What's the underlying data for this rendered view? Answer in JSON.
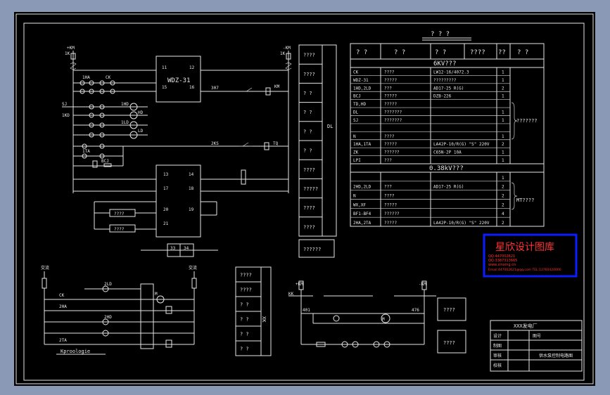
{
  "drawing": {
    "background_color": "#000000",
    "line_color": "#e6e6e6",
    "frame_color": "#8a9ab6"
  },
  "top_left": {
    "relay_label": "WDZ-31",
    "device_terminals": [
      "11",
      "12",
      "15",
      "16"
    ],
    "terminal_block_pins": [
      "13",
      "14",
      "17",
      "18",
      "20",
      "19",
      "21"
    ],
    "bottom_terminals": [
      "33",
      "34"
    ],
    "aux_boxes": [
      "????",
      "????"
    ]
  },
  "device_column": {
    "items": [
      "????",
      "????",
      "?  ?",
      "?  ?",
      "?  ?",
      "?  ?",
      "????",
      "?????",
      "????",
      "????"
    ],
    "side_label": "DL",
    "bottom_box": "??????"
  },
  "equipment_table": {
    "title": "?  ?  ?",
    "headers": [
      "?  ?",
      "?  ?",
      "?  ?",
      "????",
      "??",
      "?  ?"
    ],
    "section_6kv": "6KV???",
    "rows_6kv": [
      {
        "code": "CK",
        "name": "????",
        "model": "LW12-16/4072.3",
        "qty": "1"
      },
      {
        "code": "WDZ-31",
        "name": "?????",
        "model": "?????????",
        "qty": "1"
      },
      {
        "code": "1HD,2LD",
        "name": "???",
        "model": "AD17-25   R(G)",
        "qty": "2"
      },
      {
        "code": "BCJ",
        "name": "?????",
        "model": "DZB-226",
        "qty": "1"
      },
      {
        "code": "TD,HD",
        "name": "?????",
        "model": "",
        "qty": ""
      },
      {
        "code": "DL",
        "name": "???????",
        "model": "",
        "qty": "1"
      },
      {
        "code": "SJ",
        "name": "???????",
        "model": "",
        "qty": "1"
      },
      {
        "code": "",
        "name": "",
        "model": "",
        "qty": ""
      },
      {
        "code": "N",
        "name": "????",
        "model": "",
        "qty": "1"
      },
      {
        "code": "1HA,1TA",
        "name": "?????",
        "model": "LA42P-10/R(G) \"S\" 220V",
        "qty": "2"
      },
      {
        "code": "ZK",
        "name": "??????",
        "model": "C65N-2P     10A",
        "qty": "1"
      },
      {
        "code": "LPI",
        "name": "???",
        "model": "",
        "qty": "1"
      }
    ],
    "bracket_6kv": "???????",
    "section_038kv": "0.38kV???",
    "rows_038kv": [
      {
        "code": "",
        "name": "",
        "model": "",
        "qty": "1"
      },
      {
        "code": "2HD,2LD",
        "name": "???",
        "model": "AD17-25   R(G)",
        "qty": "2"
      },
      {
        "code": "N",
        "name": "????",
        "model": "",
        "qty": "2"
      },
      {
        "code": "WX,XF",
        "name": "?????",
        "model": "",
        "qty": "2"
      },
      {
        "code": "BF1-BF4",
        "name": "??????",
        "model": "",
        "qty": "4"
      },
      {
        "code": "2HA,2TA",
        "name": "?????",
        "model": "LA42P-10/R(G) \"S\" 220V",
        "qty": "2"
      }
    ],
    "bracket_038kv": "MT????"
  },
  "watermark": {
    "title": "星欣设计图库",
    "lines": [
      "QQ:447002621",
      "QQ:3387313665",
      "www.xinxing.cn",
      "Email:447002621@qq.com TEL:13760420000"
    ],
    "border_color": "#0b1cff",
    "text_color": "#ff3333"
  },
  "title_block": {
    "company": "XXX发电厂",
    "rows": [
      {
        "label": "设计",
        "value": "图号"
      },
      {
        "label": "制图",
        "value": ""
      },
      {
        "label": "审核",
        "value": "供水泵控制电路图"
      },
      {
        "label": "校核",
        "value": ""
      }
    ]
  },
  "bottom_left": {
    "bus_left": "交流",
    "bus_right": "交流",
    "bottom_label": "Kproologie"
  },
  "bottom_middle": {
    "items": [
      "????",
      "????",
      "?  ?",
      "?  ?",
      "?  ?",
      "?  ?"
    ],
    "side_label": "XK"
  },
  "bottom_right": {
    "boxes": [
      "????",
      "????"
    ]
  }
}
